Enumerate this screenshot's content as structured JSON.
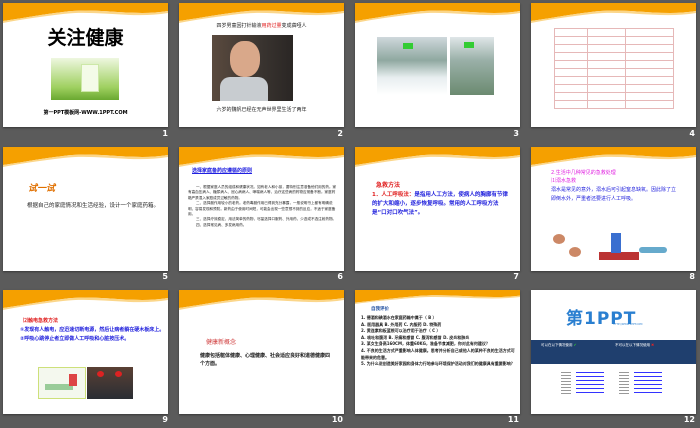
{
  "slides": [
    {
      "number": "1",
      "title": "关注健康",
      "footer": "第一PPT模板网-WWW.1PPT.COM"
    },
    {
      "number": "2",
      "caption_top_a": "四岁男童因打针输液",
      "caption_top_red": "用药过量",
      "caption_top_b": "变成聋哑人",
      "caption_bottom": "六岁的魏帆已经在无声世界里生活了两年"
    },
    {
      "number": "3"
    },
    {
      "number": "4"
    },
    {
      "number": "5",
      "badge": "试一试",
      "text": "根据自己的家庭情况和生活经验，设计一个家庭药箱。"
    },
    {
      "number": "6",
      "title": "选择家庭备药应遵循的原则",
      "paragraphs": [
        "一、根据家庭人员的组成和健康状况。如有老人和小孩，要特别注意准备他们用的药。家有高血压病人、糖尿病人、冠心病病人、哮喘病人等，治疗这些病的药物应常备不断。家庭药箱严禁混入家庭成员过敏的药物。",
        "二、选择副作用较小的老药。老药毒副作用已得到充分暴露，一般说明书上都有明确说明，容易发现和预防。新药由于使用时间短，可能会出现一些意想不到的反应，不适于家庭备用。",
        "三、选择疗效稳定、用法简单的药物，尽量选择口服药、外用药，少选或不选注射药物。",
        "四、选择常见病、多发病用药。"
      ]
    },
    {
      "number": "7",
      "title": "急救方法",
      "item_label": "1．人工呼吸法：",
      "item_text": "是指用人工方法，使病人的胸廓有节律的扩大和缩小，逐步恢复呼吸。常用的人工呼吸方法是“口对口吹气法”。"
    },
    {
      "number": "8",
      "heading": "2.生活中几种常见的急救处理",
      "subheading": "⑴溺水急救",
      "text": "溺水是常见的意外，溺水后可引起窒息缺氧。因此除了立即倒水外，严重者还要进行人工呼吸。"
    },
    {
      "number": "9",
      "title": "⑵触电急救方法",
      "item1": "①发现有人触电，应迅速切断电源，然后让病者躺在硬木板床上。",
      "item2": "②呼吸心跳停止者立即做人工呼吸和心脏按压术。"
    },
    {
      "number": "10",
      "title": "健康新概念",
      "text": "健康包括躯体健康、心理健康、社会适应良好和道德健康四个方面。"
    },
    {
      "number": "11",
      "title": "自我评价",
      "lines": [
        "1. 德酒和碘酒水在家庭药箱中属于（  B  ）",
        "A. 医用器具   B. 外用药   C. 内服药   D. 特殊药",
        "2. 黄连素和板蓝根可以治疗用于治疗（  C  ）",
        "A. 咳吐和腹泻   B. 牙痛和感冒   C. 腹泻和感冒   D. 皮炎和肺炎",
        "3. 某女生身高160CM，体重60KG，准备节食减肥，你对此有何建议？",
        "4. 不良的生活方式严重影响人体健康。思考并分析自己或他人的某种不良的生活方式可能带来的危害。",
        "5. 为什么说创造美好家园和身体力行地参与环境保护活动对我们的健康具有重要影响？"
      ]
    },
    {
      "number": "12",
      "logo": "第1PPT",
      "logo_url": "HTTP://WWW.1PPT.COM",
      "can_label": "可以在以下情况使用",
      "cannot_label": "不可以在以下情况使用"
    }
  ],
  "colors": {
    "orange": "#f5a000",
    "blue_band": "#1f3f6e",
    "logo_blue": "#2a7fd0",
    "logo_orange": "#f08a10"
  }
}
